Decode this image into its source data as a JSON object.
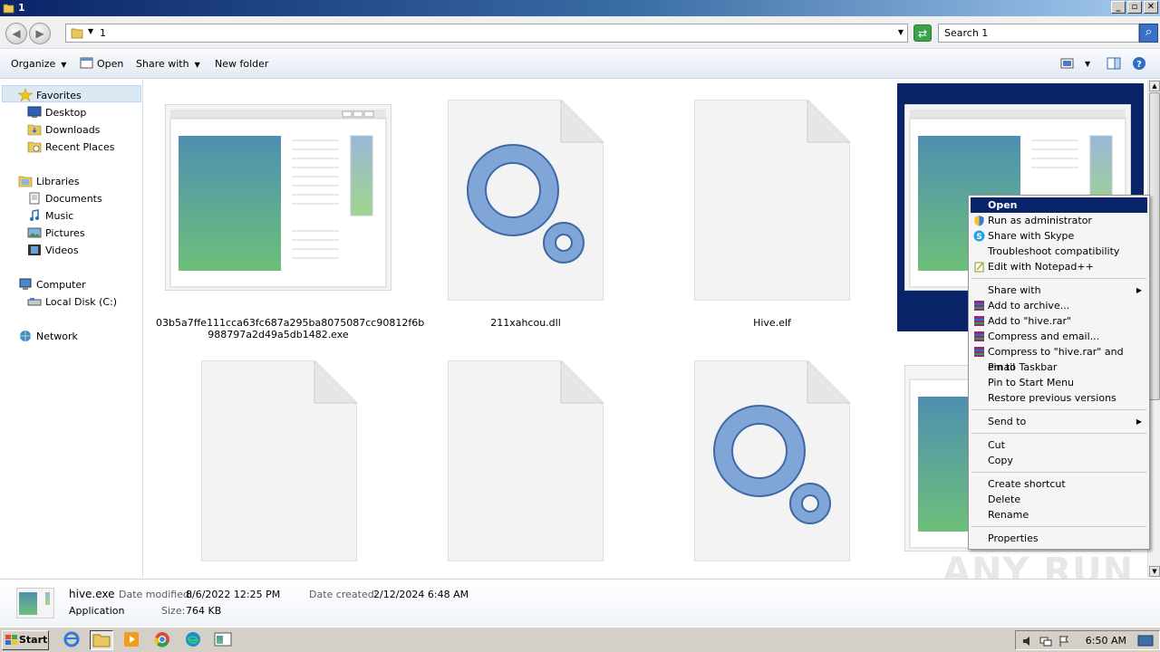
{
  "window": {
    "title": "1",
    "minimize": "_",
    "maximize": "▫",
    "close": "✕"
  },
  "address": {
    "path": "1",
    "search_placeholder": "Search 1"
  },
  "toolbar": {
    "organize": "Organize",
    "open": "Open",
    "share_with": "Share with",
    "new_folder": "New folder"
  },
  "nav": {
    "favorites": "Favorites",
    "desktop": "Desktop",
    "downloads": "Downloads",
    "recent_places": "Recent Places",
    "libraries": "Libraries",
    "documents": "Documents",
    "music": "Music",
    "pictures": "Pictures",
    "videos": "Videos",
    "computer": "Computer",
    "local_disk": "Local Disk (C:)",
    "network": "Network"
  },
  "files": [
    {
      "name": "03b5a7ffe111cca63fc687a295ba8075087cc90812f6b988797a2d49a5db1482.exe",
      "line1": "03b5a7ffe111cca63fc687a295ba8075087cc90812f6b",
      "line2": "988797a2d49a5db1482.exe",
      "type": "exe-window"
    },
    {
      "name": "211xahcou.dll",
      "type": "gear"
    },
    {
      "name": "Hive.elf",
      "type": "blank"
    },
    {
      "name": "hive.exe",
      "type": "exe-window",
      "selected": true
    },
    {
      "name": "",
      "type": "blank"
    },
    {
      "name": "",
      "type": "blank"
    },
    {
      "name": "",
      "type": "gear"
    },
    {
      "name": "",
      "type": "exe-window"
    }
  ],
  "context_menu": {
    "open": "Open",
    "run_as_admin": "Run as administrator",
    "share_skype": "Share with Skype",
    "troubleshoot": "Troubleshoot compatibility",
    "edit_notepad": "Edit with Notepad++",
    "share_with": "Share with",
    "add_archive": "Add to archive...",
    "add_rar": "Add to \"hive.rar\"",
    "compress_email": "Compress and email...",
    "compress_rar_email": "Compress to \"hive.rar\" and email",
    "pin_taskbar": "Pin to Taskbar",
    "pin_start": "Pin to Start Menu",
    "restore": "Restore previous versions",
    "send_to": "Send to",
    "cut": "Cut",
    "copy": "Copy",
    "create_shortcut": "Create shortcut",
    "delete": "Delete",
    "rename": "Rename",
    "properties": "Properties"
  },
  "details": {
    "name": "hive.exe",
    "type": "Application",
    "modified_label": "Date modified:",
    "modified": "8/6/2022 12:25 PM",
    "created_label": "Date created:",
    "created": "2/12/2024 6:48 AM",
    "size_label": "Size:",
    "size": "764 KB"
  },
  "taskbar": {
    "start": "Start",
    "clock": "6:50 AM"
  },
  "watermark": "ANY RUN",
  "colors": {
    "selection": "#0a246a",
    "title_gradient_start": "#0a246a",
    "menu_bg": "#f5f5f5"
  }
}
